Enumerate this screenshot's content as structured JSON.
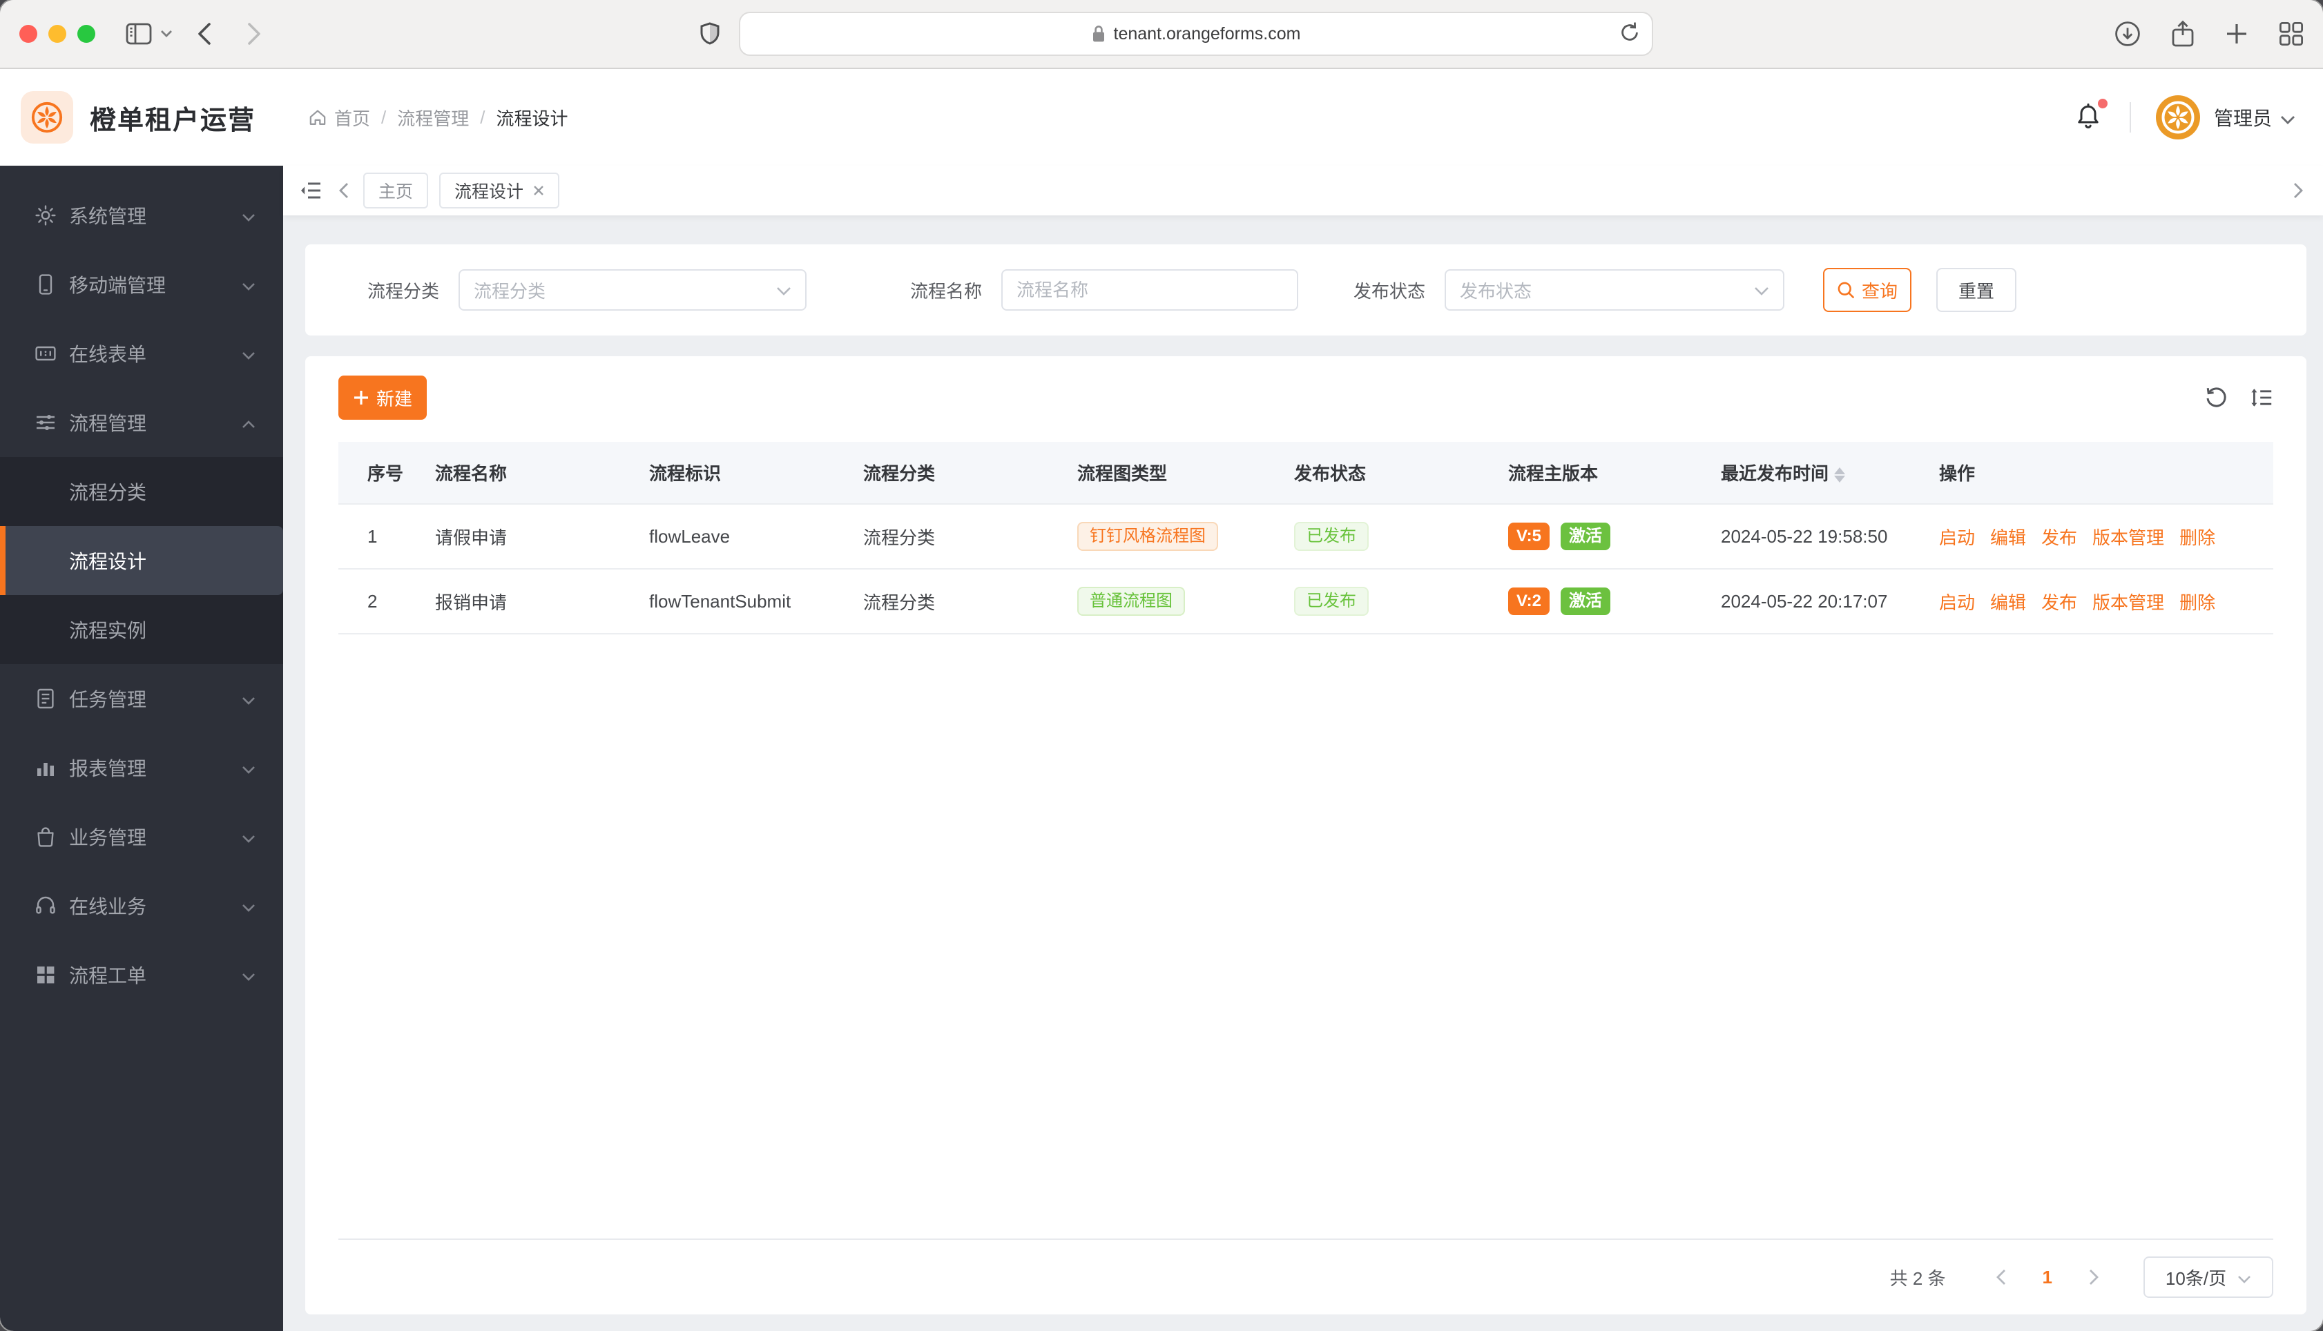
{
  "browser": {
    "url": "tenant.orangeforms.com"
  },
  "app_header": {
    "title": "橙单租户运营",
    "breadcrumb": {
      "home": "首页",
      "level2": "流程管理",
      "level3": "流程设计",
      "separator": "/"
    },
    "user_name": "管理员"
  },
  "sidebar": {
    "items": [
      {
        "label": "系统管理",
        "state": "collapsed"
      },
      {
        "label": "移动端管理",
        "state": "collapsed"
      },
      {
        "label": "在线表单",
        "state": "collapsed"
      },
      {
        "label": "流程管理",
        "state": "expanded",
        "children": [
          {
            "label": "流程分类",
            "active": false
          },
          {
            "label": "流程设计",
            "active": true
          },
          {
            "label": "流程实例",
            "active": false
          }
        ]
      },
      {
        "label": "任务管理",
        "state": "collapsed"
      },
      {
        "label": "报表管理",
        "state": "collapsed"
      },
      {
        "label": "业务管理",
        "state": "collapsed"
      },
      {
        "label": "在线业务",
        "state": "collapsed"
      },
      {
        "label": "流程工单",
        "state": "collapsed"
      }
    ]
  },
  "tabs": {
    "items": [
      {
        "label": "主页",
        "active": false,
        "closable": false
      },
      {
        "label": "流程设计",
        "active": true,
        "closable": true
      }
    ]
  },
  "filters": {
    "category": {
      "label": "流程分类",
      "placeholder": "流程分类"
    },
    "name": {
      "label": "流程名称",
      "placeholder": "流程名称"
    },
    "status": {
      "label": "发布状态",
      "placeholder": "发布状态"
    },
    "search_button": "查询",
    "reset_button": "重置"
  },
  "toolbar": {
    "create_button": "新建"
  },
  "table": {
    "columns": [
      "序号",
      "流程名称",
      "流程标识",
      "流程分类",
      "流程图类型",
      "发布状态",
      "流程主版本",
      "最近发布时间",
      "操作"
    ],
    "rows": [
      {
        "index": "1",
        "name": "请假申请",
        "flow_key": "flowLeave",
        "category": "流程分类",
        "diagram_type": "钉钉风格流程图",
        "publish_status": "已发布",
        "main_version": "V:5",
        "version_state": "激活",
        "published_at": "2024-05-22 19:58:50"
      },
      {
        "index": "2",
        "name": "报销申请",
        "flow_key": "flowTenantSubmit",
        "category": "流程分类",
        "diagram_type": "普通流程图",
        "publish_status": "已发布",
        "main_version": "V:2",
        "version_state": "激活",
        "published_at": "2024-05-22 20:17:07"
      }
    ],
    "actions": [
      "启动",
      "编辑",
      "发布",
      "版本管理",
      "删除"
    ]
  },
  "pagination": {
    "total": "共 2 条",
    "page": "1",
    "page_size": "10条/页"
  },
  "colors": {
    "accent": "#f7751f",
    "success": "#67c23a",
    "sidebar_bg": "#2d3039",
    "table_header_bg": "#f5f7fa"
  }
}
